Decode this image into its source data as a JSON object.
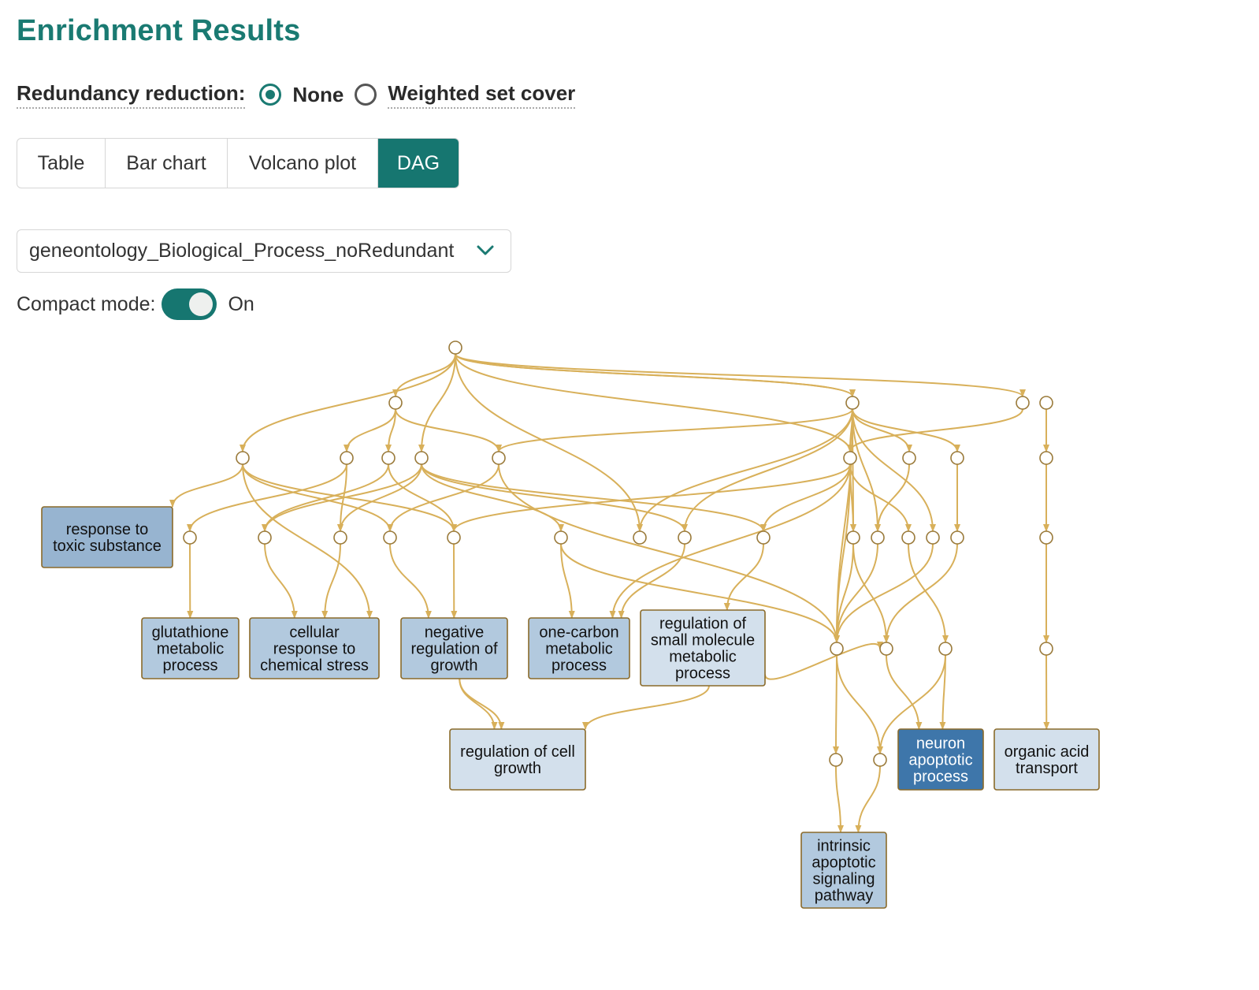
{
  "page": {
    "title": "Enrichment Results"
  },
  "redundancy": {
    "label": "Redundancy reduction:",
    "options": [
      {
        "label": "None",
        "selected": true
      },
      {
        "label": "Weighted set cover",
        "selected": false
      }
    ]
  },
  "view_tabs": [
    {
      "label": "Table",
      "active": false
    },
    {
      "label": "Bar chart",
      "active": false
    },
    {
      "label": "Volcano plot",
      "active": false
    },
    {
      "label": "DAG",
      "active": true
    }
  ],
  "database_select": {
    "value": "geneontology_Biological_Process_noRedundant",
    "icon": "chevron-down-icon"
  },
  "compact_mode": {
    "label": "Compact mode:",
    "enabled": true,
    "state_text": "On"
  },
  "dag": {
    "terms": [
      {
        "id": "t1",
        "lines": [
          "response to",
          "toxic substance"
        ]
      },
      {
        "id": "t2",
        "lines": [
          "glutathione",
          "metabolic",
          "process"
        ]
      },
      {
        "id": "t3",
        "lines": [
          "cellular",
          "response to",
          "chemical stress"
        ]
      },
      {
        "id": "t4",
        "lines": [
          "negative",
          "regulation of",
          "growth"
        ]
      },
      {
        "id": "t5",
        "lines": [
          "one-carbon",
          "metabolic",
          "process"
        ]
      },
      {
        "id": "t6",
        "lines": [
          "regulation of",
          "small molecule",
          "metabolic",
          "process"
        ]
      },
      {
        "id": "t7",
        "lines": [
          "regulation of cell",
          "growth"
        ]
      },
      {
        "id": "t8",
        "lines": [
          "neuron",
          "apoptotic",
          "process"
        ]
      },
      {
        "id": "t9",
        "lines": [
          "organic acid",
          "transport"
        ]
      },
      {
        "id": "t10",
        "lines": [
          "intrinsic",
          "apoptotic",
          "signaling",
          "pathway"
        ]
      }
    ],
    "colors": {
      "edge": "#d8b05a",
      "term_strong": "#3e76aa",
      "term_medium": "#97b4d0",
      "term_light": "#b2c9de",
      "term_pale": "#d3e0ec"
    }
  }
}
